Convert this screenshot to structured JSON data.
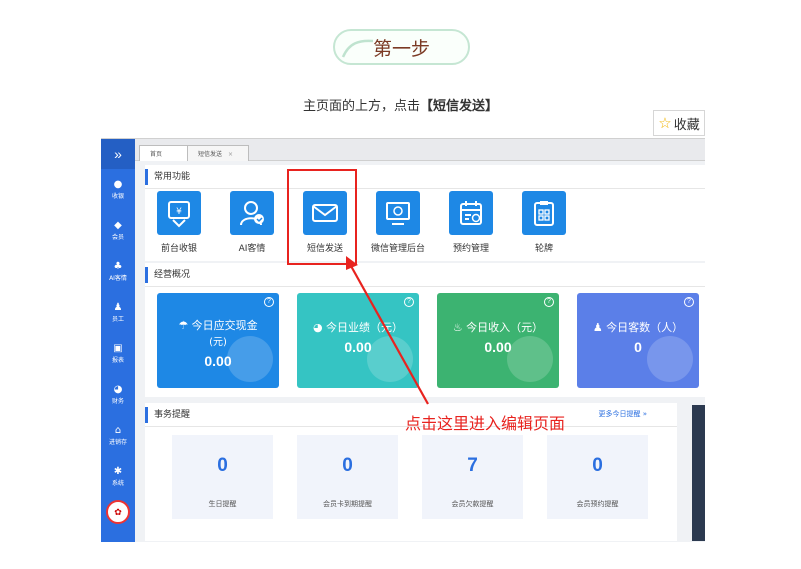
{
  "header": {
    "step_title": "第一步",
    "instruction_prefix": "主页面的上方，点击",
    "instruction_highlight": "【短信发送】",
    "favorite_label": "收藏"
  },
  "app": {
    "sidebar": {
      "toggle": "»",
      "items": [
        {
          "label": "收银",
          "icon": "cashier-icon"
        },
        {
          "label": "会员",
          "icon": "member-icon"
        },
        {
          "label": "AI客情",
          "icon": "ai-icon"
        },
        {
          "label": "员工",
          "icon": "staff-icon"
        },
        {
          "label": "报表",
          "icon": "report-icon"
        },
        {
          "label": "财务",
          "icon": "finance-icon"
        },
        {
          "label": "进销存",
          "icon": "inventory-icon"
        },
        {
          "label": "系统",
          "icon": "gear-icon"
        }
      ]
    },
    "tabs": [
      {
        "label": "首页"
      },
      {
        "label": "短信发送",
        "close": "×"
      }
    ],
    "common_functions": {
      "title": "常用功能",
      "items": [
        {
          "label": "前台收银"
        },
        {
          "label": "AI客情"
        },
        {
          "label": "短信发送"
        },
        {
          "label": "微信管理后台"
        },
        {
          "label": "预约管理"
        },
        {
          "label": "轮牌"
        }
      ]
    },
    "overview": {
      "title": "经营概况",
      "cards": [
        {
          "title_line1": "今日应交现金",
          "title_line2": "(元)",
          "value": "0.00",
          "color": "#1e88e5"
        },
        {
          "title_line1": "今日业绩（元）",
          "title_line2": "",
          "value": "0.00",
          "color": "#35c4c3"
        },
        {
          "title_line1": "今日收入（元）",
          "title_line2": "",
          "value": "0.00",
          "color": "#3cb371"
        },
        {
          "title_line1": "今日客数（人）",
          "title_line2": "",
          "value": "0",
          "color": "#5b7fe8"
        }
      ]
    },
    "reminders": {
      "title": "事务提醒",
      "more": "更多今日提醒 »",
      "items": [
        {
          "value": "0",
          "label": "生日提醒"
        },
        {
          "value": "0",
          "label": "会员卡到期提醒"
        },
        {
          "value": "7",
          "label": "会员欠款提醒"
        },
        {
          "value": "0",
          "label": "会员预约提醒"
        }
      ]
    }
  },
  "annotation": {
    "text": "点击这里进入编辑页面",
    "color": "#e8231f"
  }
}
